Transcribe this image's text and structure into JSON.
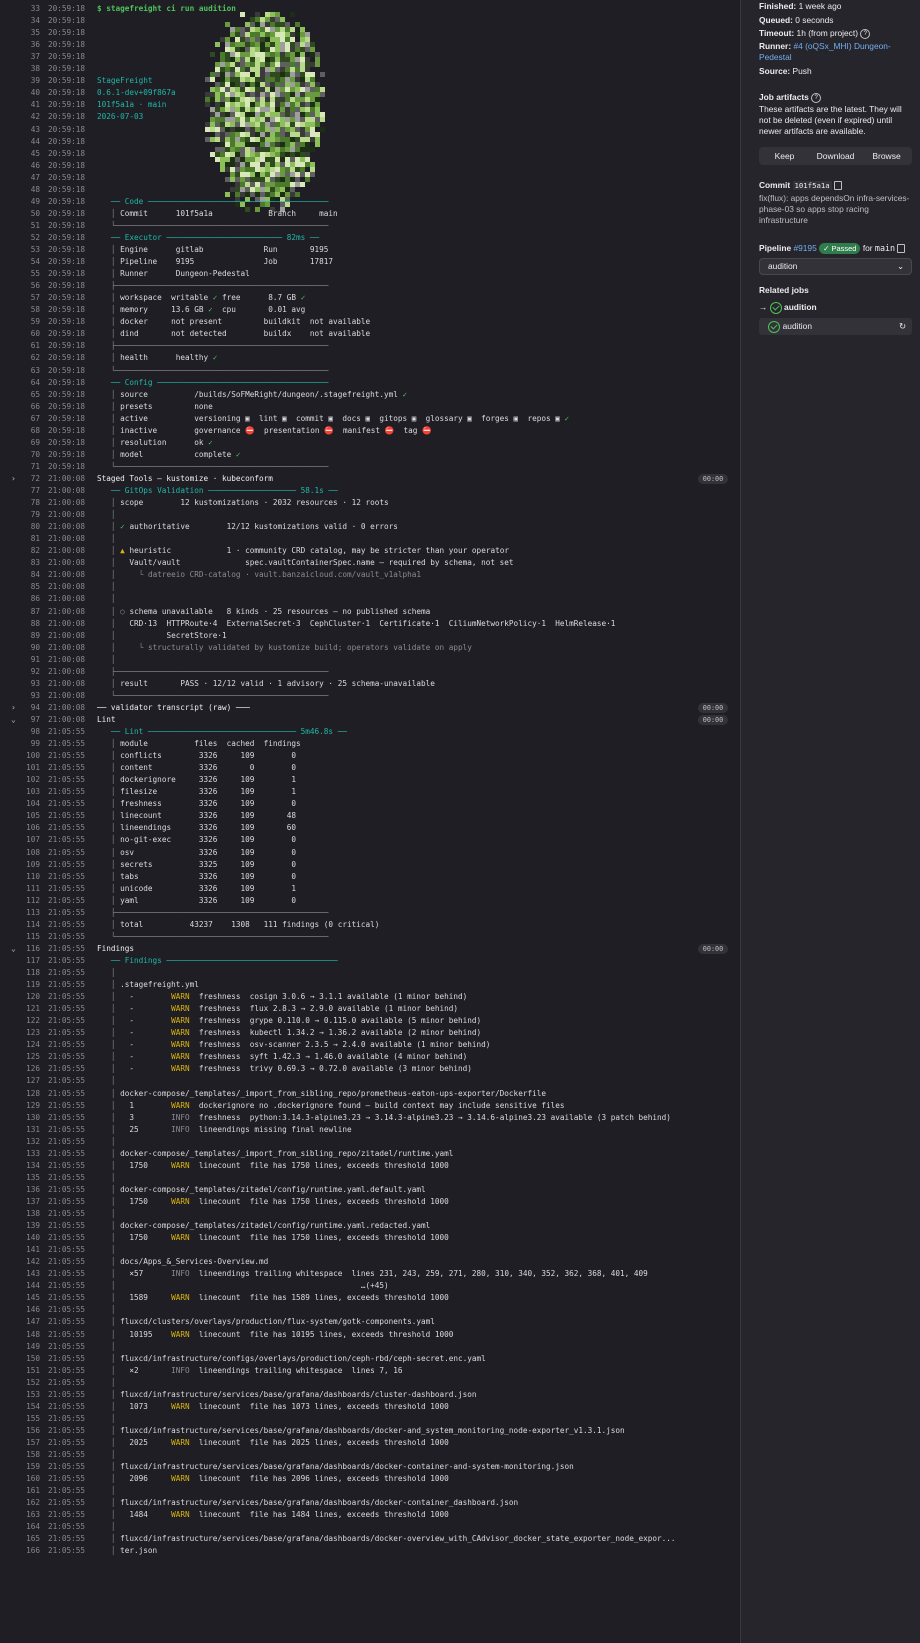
{
  "sidebar": {
    "finished_label": "Finished:",
    "finished_value": "1 week ago",
    "queued_label": "Queued:",
    "queued_value": "0 seconds",
    "timeout_label": "Timeout:",
    "timeout_value": "1h (from project)",
    "runner_label": "Runner:",
    "runner_value": "#4 (oQSx_MHI) Dungeon-Pedestal",
    "source_label": "Source:",
    "source_value": "Push",
    "artifacts_title": "Job artifacts",
    "artifacts_text": "These artifacts are the latest. They will not be deleted (even if expired) until newer artifacts are available.",
    "keep": "Keep",
    "download": "Download",
    "browse": "Browse",
    "commit_label": "Commit",
    "commit_sha": "101f5a1a",
    "commit_msg": "fix(flux): apps dependsOn infra-services-phase-03 so apps stop racing infrastructure",
    "pipeline_label": "Pipeline",
    "pipeline_id": "#9195",
    "pipeline_status": "Passed",
    "pipeline_for": "for",
    "pipeline_branch": "main",
    "stage_select": "audition",
    "related_title": "Related jobs",
    "job1": "audition",
    "job2": "audition",
    "icons": [
      "help-icon",
      "copy-icon",
      "chevron-down-icon",
      "retry-icon",
      "status-passed-icon",
      "arrow-right-icon"
    ]
  },
  "log": [
    {
      "n": "33",
      "t": "20:59:18",
      "h": "<span class='gr bo'>$ stagefreight ci run audition</span>"
    },
    {
      "n": "34",
      "t": "20:59:18",
      "h": ""
    },
    {
      "n": "35",
      "t": "20:59:18",
      "h": ""
    },
    {
      "n": "36",
      "t": "20:59:18",
      "h": ""
    },
    {
      "n": "37",
      "t": "20:59:18",
      "h": ""
    },
    {
      "n": "38",
      "t": "20:59:18",
      "h": ""
    },
    {
      "n": "39",
      "t": "20:59:18",
      "h": "<span class='cy'>StageFreight</span>"
    },
    {
      "n": "40",
      "t": "20:59:18",
      "h": "<span class='cy'>0.6.1-dev+09f867a</span>"
    },
    {
      "n": "41",
      "t": "20:59:18",
      "h": "<span class='cy'>101f5a1a · main</span>"
    },
    {
      "n": "42",
      "t": "20:59:18",
      "h": "<span class='cy'>2026-07-03</span>"
    },
    {
      "n": "43",
      "t": "20:59:18",
      "h": ""
    },
    {
      "n": "44",
      "t": "20:59:18",
      "h": ""
    },
    {
      "n": "45",
      "t": "20:59:18",
      "h": ""
    },
    {
      "n": "46",
      "t": "20:59:18",
      "h": ""
    },
    {
      "n": "47",
      "t": "20:59:18",
      "h": ""
    },
    {
      "n": "48",
      "t": "20:59:18",
      "h": ""
    },
    {
      "n": "49",
      "t": "20:59:18",
      "h": "   <span class='cy'>── Code ───────────────────────────────────────</span>"
    },
    {
      "n": "50",
      "t": "20:59:18",
      "h": "   <span class='dim'>│</span> Commit      101f5a1a            Branch     main"
    },
    {
      "n": "51",
      "t": "20:59:18",
      "h": "   <span class='dim'>└──────────────────────────────────────────────</span>"
    },
    {
      "n": "52",
      "t": "20:59:18",
      "h": "   <span class='cy'>── Executor ───────────────────────── 82ms ──</span>"
    },
    {
      "n": "53",
      "t": "20:59:18",
      "h": "   <span class='dim'>│</span> Engine      gitlab             Run       9195"
    },
    {
      "n": "54",
      "t": "20:59:18",
      "h": "   <span class='dim'>│</span> Pipeline    9195               Job       17817"
    },
    {
      "n": "55",
      "t": "20:59:18",
      "h": "   <span class='dim'>│</span> Runner      Dungeon-Pedestal"
    },
    {
      "n": "56",
      "t": "20:59:18",
      "h": "   <span class='dim'>├──────────────────────────────────────────────</span>"
    },
    {
      "n": "57",
      "t": "20:59:18",
      "h": "   <span class='dim'>│</span> workspace  writable <span class='gr'>✓</span> free      8.7 GB <span class='gr'>✓</span>"
    },
    {
      "n": "58",
      "t": "20:59:18",
      "h": "   <span class='dim'>│</span> memory     13.6 GB <span class='gr'>✓</span>  cpu       0.01 avg"
    },
    {
      "n": "59",
      "t": "20:59:18",
      "h": "   <span class='dim'>│</span> docker     not present         buildkit  not available"
    },
    {
      "n": "60",
      "t": "20:59:18",
      "h": "   <span class='dim'>│</span> dind       not detected        buildx    not available"
    },
    {
      "n": "61",
      "t": "20:59:18",
      "h": "   <span class='dim'>├──────────────────────────────────────────────</span>"
    },
    {
      "n": "62",
      "t": "20:59:18",
      "h": "   <span class='dim'>│</span> health      healthy <span class='gr'>✓</span>"
    },
    {
      "n": "63",
      "t": "20:59:18",
      "h": "   <span class='dim'>└──────────────────────────────────────────────</span>"
    },
    {
      "n": "64",
      "t": "20:59:18",
      "h": "   <span class='cy'>── Config ─────────────────────────────────────</span>"
    },
    {
      "n": "65",
      "t": "20:59:18",
      "h": "   <span class='dim'>│</span> source          /builds/SoFMeRight/dungeon/.stagefreight.yml <span class='gr'>✓</span>"
    },
    {
      "n": "66",
      "t": "20:59:18",
      "h": "   <span class='dim'>│</span> presets         none"
    },
    {
      "n": "67",
      "t": "20:59:18",
      "h": "   <span class='dim'>│</span> active          versioning ▣  lint ▣  commit ▣  docs ▣  gitops ▣  glossary ▣  forges ▣  repos ▣ <span class='gr'>✓</span>"
    },
    {
      "n": "68",
      "t": "20:59:18",
      "h": "   <span class='dim'>│</span> inactive        governance <span style='color:#e05656'>⛔</span>  presentation <span style='color:#e05656'>⛔</span>  manifest <span style='color:#e05656'>⛔</span>  tag <span style='color:#e05656'>⛔</span>"
    },
    {
      "n": "69",
      "t": "20:59:18",
      "h": "   <span class='dim'>│</span> resolution      ok <span class='gr'>✓</span>"
    },
    {
      "n": "70",
      "t": "20:59:18",
      "h": "   <span class='dim'>│</span> model           complete <span class='gr'>✓</span>"
    },
    {
      "n": "71",
      "t": "20:59:18",
      "h": "   <span class='dim'>└──────────────────────────────────────────────</span>"
    },
    {
      "n": "72",
      "t": "21:00:08",
      "h": "<span class='wh'>Staged Tools — kustomize · kubeconform</span>",
      "chev": "›",
      "dur": "00:00"
    },
    {
      "n": "77",
      "t": "21:00:08",
      "h": "   <span class='cy'>── GitOps Validation ─────────────────── 58.1s ──</span>"
    },
    {
      "n": "78",
      "t": "21:00:08",
      "h": "   <span class='dim'>│</span> scope        12 kustomizations · 2032 resources · 12 roots"
    },
    {
      "n": "79",
      "t": "21:00:08",
      "h": "   <span class='dim'>│</span>"
    },
    {
      "n": "80",
      "t": "21:00:08",
      "h": "   <span class='dim'>│</span> <span class='gr'>✓</span> authoritative        12/12 kustomizations valid · 0 errors"
    },
    {
      "n": "81",
      "t": "21:00:08",
      "h": "   <span class='dim'>│</span>"
    },
    {
      "n": "82",
      "t": "21:00:08",
      "h": "   <span class='dim'>│</span> <span class='ye'>▲</span> heuristic            1 · community CRD catalog, may be stricter than your operator"
    },
    {
      "n": "83",
      "t": "21:00:08",
      "h": "   <span class='dim'>│</span>   Vault/vault              spec.vaultContainerSpec.name — required by schema, not set"
    },
    {
      "n": "84",
      "t": "21:00:08",
      "h": "   <span class='dim'>│</span>     <span class='dim'>└ datreeio CRD-catalog · vault.banzaicloud.com/vault_v1alpha1</span>"
    },
    {
      "n": "85",
      "t": "21:00:08",
      "h": "   <span class='dim'>│</span>"
    },
    {
      "n": "86",
      "t": "21:00:08",
      "h": "   <span class='dim'>│</span>"
    },
    {
      "n": "87",
      "t": "21:00:08",
      "h": "   <span class='dim'>│</span> <span class='dim'>○</span> schema unavailable   8 kinds · 25 resources — no published schema"
    },
    {
      "n": "88",
      "t": "21:00:08",
      "h": "   <span class='dim'>│</span>   CRD·13  HTTPRoute·4  ExternalSecret·3  CephCluster·1  Certificate·1  CiliumNetworkPolicy·1  HelmRelease·1"
    },
    {
      "n": "89",
      "t": "21:00:08",
      "h": "   <span class='dim'>│</span>           SecretStore·1"
    },
    {
      "n": "90",
      "t": "21:00:08",
      "h": "   <span class='dim'>│</span>     <span class='dim'>└ structurally validated by kustomize build; operators validate on apply</span>"
    },
    {
      "n": "91",
      "t": "21:00:08",
      "h": "   <span class='dim'>│</span>"
    },
    {
      "n": "92",
      "t": "21:00:08",
      "h": "   <span class='dim'>├──────────────────────────────────────────────</span>"
    },
    {
      "n": "93",
      "t": "21:00:08",
      "h": "   <span class='dim'>│</span> result       PASS · 12/12 valid · 1 advisory · 25 schema-unavailable"
    },
    {
      "n": "93",
      "t": "21:00:08",
      "h": "   <span class='dim'>└──────────────────────────────────────────────</span>"
    },
    {
      "n": "94",
      "t": "21:00:08",
      "h": "<span class='wh'>── validator transcript (raw) ───</span>",
      "chev": "›",
      "dur": "00:00"
    },
    {
      "n": "97",
      "t": "21:00:08",
      "h": "<span class='wh'>Lint</span>",
      "chev": "⌄",
      "dur": "00:00"
    },
    {
      "n": "98",
      "t": "21:05:55",
      "h": "   <span class='cy'>── Lint ──────────────────────────────── 5m46.8s ──</span>"
    },
    {
      "n": "99",
      "t": "21:05:55",
      "h": "   <span class='dim'>│</span> module          files  cached  findings"
    },
    {
      "n": "100",
      "t": "21:05:55",
      "h": "   <span class='dim'>│</span> conflicts        3326     109        0"
    },
    {
      "n": "101",
      "t": "21:05:55",
      "h": "   <span class='dim'>│</span> content          3326       0        0"
    },
    {
      "n": "102",
      "t": "21:05:55",
      "h": "   <span class='dim'>│</span> dockerignore     3326     109        1"
    },
    {
      "n": "103",
      "t": "21:05:55",
      "h": "   <span class='dim'>│</span> filesize         3326     109        1"
    },
    {
      "n": "104",
      "t": "21:05:55",
      "h": "   <span class='dim'>│</span> freshness        3326     109        0"
    },
    {
      "n": "105",
      "t": "21:05:55",
      "h": "   <span class='dim'>│</span> linecount        3326     109       48"
    },
    {
      "n": "106",
      "t": "21:05:55",
      "h": "   <span class='dim'>│</span> lineendings      3326     109       60"
    },
    {
      "n": "107",
      "t": "21:05:55",
      "h": "   <span class='dim'>│</span> no-git-exec      3326     109        0"
    },
    {
      "n": "108",
      "t": "21:05:55",
      "h": "   <span class='dim'>│</span> osv              3326     109        0"
    },
    {
      "n": "109",
      "t": "21:05:55",
      "h": "   <span class='dim'>│</span> secrets          3325     109        0"
    },
    {
      "n": "110",
      "t": "21:05:55",
      "h": "   <span class='dim'>│</span> tabs             3326     109        0"
    },
    {
      "n": "111",
      "t": "21:05:55",
      "h": "   <span class='dim'>│</span> unicode          3326     109        1"
    },
    {
      "n": "112",
      "t": "21:05:55",
      "h": "   <span class='dim'>│</span> yaml             3326     109        0"
    },
    {
      "n": "113",
      "t": "21:05:55",
      "h": "   <span class='dim'>├──────────────────────────────────────────────</span>"
    },
    {
      "n": "114",
      "t": "21:05:55",
      "h": "   <span class='dim'>│</span> total          43237    1308   111 findings (0 critical)"
    },
    {
      "n": "115",
      "t": "21:05:55",
      "h": "   <span class='dim'>└──────────────────────────────────────────────</span>"
    },
    {
      "n": "116",
      "t": "21:05:55",
      "h": "<span class='wh'>Findings</span>",
      "chev": "⌄",
      "dur": "00:00"
    },
    {
      "n": "117",
      "t": "21:05:55",
      "h": "   <span class='cy'>── Findings ─────────────────────────────────────</span>"
    },
    {
      "n": "118",
      "t": "21:05:55",
      "h": "   <span class='dim'>│</span>"
    },
    {
      "n": "119",
      "t": "21:05:55",
      "h": "   <span class='dim'>│</span> .stagefreight.yml"
    },
    {
      "n": "120",
      "t": "21:05:55",
      "h": "   <span class='dim'>│</span>   -        <span class='ye'>WARN</span>  freshness  cosign 3.0.6 → 3.1.1 available (1 minor behind)"
    },
    {
      "n": "121",
      "t": "21:05:55",
      "h": "   <span class='dim'>│</span>   -        <span class='ye'>WARN</span>  freshness  flux 2.8.3 → 2.9.0 available (1 minor behind)"
    },
    {
      "n": "122",
      "t": "21:05:55",
      "h": "   <span class='dim'>│</span>   -        <span class='ye'>WARN</span>  freshness  grype 0.110.0 → 0.115.0 available (5 minor behind)"
    },
    {
      "n": "123",
      "t": "21:05:55",
      "h": "   <span class='dim'>│</span>   -        <span class='ye'>WARN</span>  freshness  kubectl 1.34.2 → 1.36.2 available (2 minor behind)"
    },
    {
      "n": "124",
      "t": "21:05:55",
      "h": "   <span class='dim'>│</span>   -        <span class='ye'>WARN</span>  freshness  osv-scanner 2.3.5 → 2.4.0 available (1 minor behind)"
    },
    {
      "n": "125",
      "t": "21:05:55",
      "h": "   <span class='dim'>│</span>   -        <span class='ye'>WARN</span>  freshness  syft 1.42.3 → 1.46.0 available (4 minor behind)"
    },
    {
      "n": "126",
      "t": "21:05:55",
      "h": "   <span class='dim'>│</span>   -        <span class='ye'>WARN</span>  freshness  trivy 0.69.3 → 0.72.0 available (3 minor behind)"
    },
    {
      "n": "127",
      "t": "21:05:55",
      "h": "   <span class='dim'>│</span>"
    },
    {
      "n": "128",
      "t": "21:05:55",
      "h": "   <span class='dim'>│</span> docker-compose/_templates/_import_from_sibling_repo/prometheus-eaton-ups-exporter/Dockerfile"
    },
    {
      "n": "129",
      "t": "21:05:55",
      "h": "   <span class='dim'>│</span>   1        <span class='ye'>WARN</span>  dockerignore no .dockerignore found — build context may include sensitive files"
    },
    {
      "n": "130",
      "t": "21:05:55",
      "h": "   <span class='dim'>│</span>   3        <span class='dim'>INFO</span>  freshness  python:3.14.3-alpine3.23 → 3.14.3-alpine3.23 → 3.14.6-alpine3.23 available (3 patch behind)"
    },
    {
      "n": "131",
      "t": "21:05:55",
      "h": "   <span class='dim'>│</span>   25       <span class='dim'>INFO</span>  lineendings missing final newline"
    },
    {
      "n": "132",
      "t": "21:05:55",
      "h": "   <span class='dim'>│</span>"
    },
    {
      "n": "133",
      "t": "21:05:55",
      "h": "   <span class='dim'>│</span> docker-compose/_templates/_import_from_sibling_repo/zitadel/runtime.yaml"
    },
    {
      "n": "134",
      "t": "21:05:55",
      "h": "   <span class='dim'>│</span>   1750     <span class='ye'>WARN</span>  linecount  file has 1750 lines, exceeds threshold 1000"
    },
    {
      "n": "135",
      "t": "21:05:55",
      "h": "   <span class='dim'>│</span>"
    },
    {
      "n": "136",
      "t": "21:05:55",
      "h": "   <span class='dim'>│</span> docker-compose/_templates/zitadel/config/runtime.yaml.default.yaml"
    },
    {
      "n": "137",
      "t": "21:05:55",
      "h": "   <span class='dim'>│</span>   1750     <span class='ye'>WARN</span>  linecount  file has 1750 lines, exceeds threshold 1000"
    },
    {
      "n": "138",
      "t": "21:05:55",
      "h": "   <span class='dim'>│</span>"
    },
    {
      "n": "139",
      "t": "21:05:55",
      "h": "   <span class='dim'>│</span> docker-compose/_templates/zitadel/config/runtime.yaml.redacted.yaml"
    },
    {
      "n": "140",
      "t": "21:05:55",
      "h": "   <span class='dim'>│</span>   1750     <span class='ye'>WARN</span>  linecount  file has 1750 lines, exceeds threshold 1000"
    },
    {
      "n": "141",
      "t": "21:05:55",
      "h": "   <span class='dim'>│</span>"
    },
    {
      "n": "142",
      "t": "21:05:55",
      "h": "   <span class='dim'>│</span> docs/Apps_&amp;_Services-Overview.md"
    },
    {
      "n": "143",
      "t": "21:05:55",
      "h": "   <span class='dim'>│</span>   ×57      <span class='dim'>INFO</span>  lineendings trailing whitespace  lines 231, 243, 259, 271, 280, 310, 340, 352, 362, 368, 401, 409"
    },
    {
      "n": "144",
      "t": "21:05:55",
      "h": "   <span class='dim'>│</span>                                                     …(+45)"
    },
    {
      "n": "145",
      "t": "21:05:55",
      "h": "   <span class='dim'>│</span>   1589     <span class='ye'>WARN</span>  linecount  file has 1589 lines, exceeds threshold 1000"
    },
    {
      "n": "146",
      "t": "21:05:55",
      "h": "   <span class='dim'>│</span>"
    },
    {
      "n": "147",
      "t": "21:05:55",
      "h": "   <span class='dim'>│</span> fluxcd/clusters/overlays/production/flux-system/gotk-components.yaml"
    },
    {
      "n": "148",
      "t": "21:05:55",
      "h": "   <span class='dim'>│</span>   10195    <span class='ye'>WARN</span>  linecount  file has 10195 lines, exceeds threshold 1000"
    },
    {
      "n": "149",
      "t": "21:05:55",
      "h": "   <span class='dim'>│</span>"
    },
    {
      "n": "150",
      "t": "21:05:55",
      "h": "   <span class='dim'>│</span> fluxcd/infrastructure/configs/overlays/production/ceph-rbd/ceph-secret.enc.yaml"
    },
    {
      "n": "151",
      "t": "21:05:55",
      "h": "   <span class='dim'>│</span>   ×2       <span class='dim'>INFO</span>  lineendings trailing whitespace  lines 7, 16"
    },
    {
      "n": "152",
      "t": "21:05:55",
      "h": "   <span class='dim'>│</span>"
    },
    {
      "n": "153",
      "t": "21:05:55",
      "h": "   <span class='dim'>│</span> fluxcd/infrastructure/services/base/grafana/dashboards/cluster-dashboard.json"
    },
    {
      "n": "154",
      "t": "21:05:55",
      "h": "   <span class='dim'>│</span>   1073     <span class='ye'>WARN</span>  linecount  file has 1073 lines, exceeds threshold 1000"
    },
    {
      "n": "155",
      "t": "21:05:55",
      "h": "   <span class='dim'>│</span>"
    },
    {
      "n": "156",
      "t": "21:05:55",
      "h": "   <span class='dim'>│</span> fluxcd/infrastructure/services/base/grafana/dashboards/docker-and_system_monitoring_node-exporter_v1.3.1.json"
    },
    {
      "n": "157",
      "t": "21:05:55",
      "h": "   <span class='dim'>│</span>   2025     <span class='ye'>WARN</span>  linecount  file has 2025 lines, exceeds threshold 1000"
    },
    {
      "n": "158",
      "t": "21:05:55",
      "h": "   <span class='dim'>│</span>"
    },
    {
      "n": "159",
      "t": "21:05:55",
      "h": "   <span class='dim'>│</span> fluxcd/infrastructure/services/base/grafana/dashboards/docker-container-and-system-monitoring.json"
    },
    {
      "n": "160",
      "t": "21:05:55",
      "h": "   <span class='dim'>│</span>   2096     <span class='ye'>WARN</span>  linecount  file has 2096 lines, exceeds threshold 1000"
    },
    {
      "n": "161",
      "t": "21:05:55",
      "h": "   <span class='dim'>│</span>"
    },
    {
      "n": "162",
      "t": "21:05:55",
      "h": "   <span class='dim'>│</span> fluxcd/infrastructure/services/base/grafana/dashboards/docker-container_dashboard.json"
    },
    {
      "n": "163",
      "t": "21:05:55",
      "h": "   <span class='dim'>│</span>   1484     <span class='ye'>WARN</span>  linecount  file has 1484 lines, exceeds threshold 1000"
    },
    {
      "n": "164",
      "t": "21:05:55",
      "h": "   <span class='dim'>│</span>"
    },
    {
      "n": "165",
      "t": "21:05:55",
      "h": "   <span class='dim'>│</span> fluxcd/infrastructure/services/base/grafana/dashboards/docker-overview_with_CAdvisor_docker_state_exporter_node_expor..."
    },
    {
      "n": "166",
      "t": "21:05:55",
      "h": "   <span class='dim'>│</span> ter.json"
    }
  ]
}
